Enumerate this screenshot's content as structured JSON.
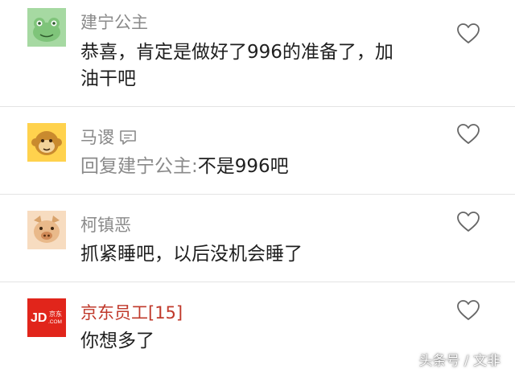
{
  "comments": [
    {
      "username": "建宁公主",
      "avatar_icon": "frog-avatar-icon",
      "text_line1": "恭喜，肯定是做好了996的准备了，加",
      "text_line2": "油干吧"
    },
    {
      "username": "马谡",
      "avatar_icon": "monkey-avatar-icon",
      "reply_prefix": "回复建宁公主:",
      "text": "不是996吧"
    },
    {
      "username": "柯镇恶",
      "avatar_icon": "pig-avatar-icon",
      "text": "抓紧睡吧，以后没机会睡了"
    },
    {
      "username": "京东员工[15]",
      "avatar_icon": "jd-logo-avatar",
      "avatar_logo_text": "JD.京东.COM",
      "text": "你想多了"
    }
  ],
  "watermark": "头条号 / 文非",
  "colors": {
    "username_gray": "#8a8a8a",
    "username_red": "#c0392b",
    "text": "#1f1f1f",
    "divider": "#e3e3e3",
    "jd_red": "#e1251b",
    "frog_bg": "#a6d9a2",
    "monkey_bg": "#ffd24d",
    "pig_bg": "#f7dcc0"
  },
  "icons": {
    "like": "heart-outline-icon",
    "message": "chat-bubble-icon"
  }
}
